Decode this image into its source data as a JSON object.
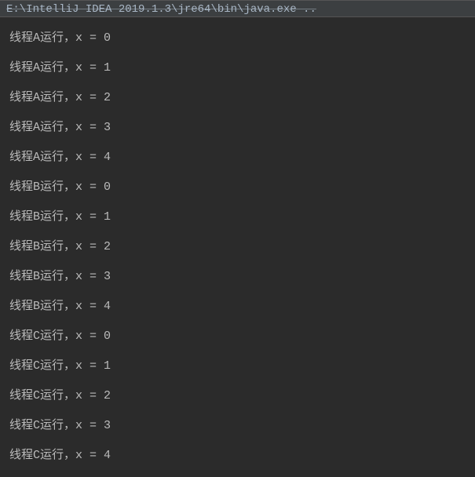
{
  "header": {
    "command_path": "E:\\IntelliJ IDEA 2019.1.3\\jre64\\bin\\java.exe  .."
  },
  "output": {
    "lines": [
      "线程A运行，x = 0",
      "线程A运行，x = 1",
      "线程A运行，x = 2",
      "线程A运行，x = 3",
      "线程A运行，x = 4",
      "线程B运行，x = 0",
      "线程B运行，x = 1",
      "线程B运行，x = 2",
      "线程B运行，x = 3",
      "线程B运行，x = 4",
      "线程C运行，x = 0",
      "线程C运行，x = 1",
      "线程C运行，x = 2",
      "线程C运行，x = 3",
      "线程C运行，x = 4"
    ]
  }
}
